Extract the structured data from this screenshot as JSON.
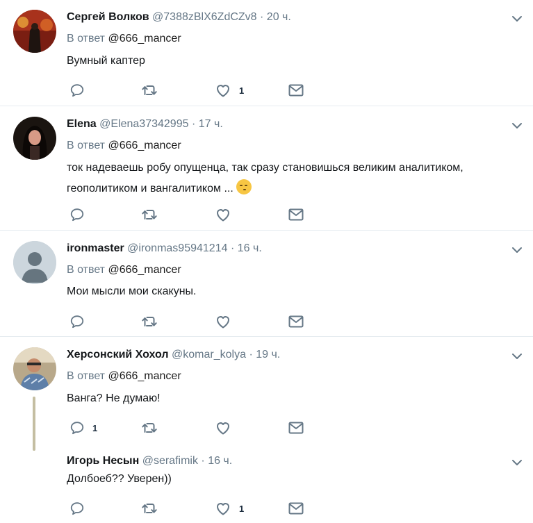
{
  "tweets": [
    {
      "name": "Сергей Волков",
      "handle": "@7388zBlX6ZdCZv8",
      "time": "20 ч.",
      "reply_prefix": "В ответ",
      "reply_to": "@666_mancer",
      "text": "Вумный каптер",
      "reply_count": "",
      "like_count": "1"
    },
    {
      "name": "Elena",
      "handle": "@Elena37342995",
      "time": "17 ч.",
      "reply_prefix": "В ответ",
      "reply_to": "@666_mancer",
      "text_line1": "ток надеваешь робу опущенца, так сразу становишься великим аналитиком,",
      "text_line2": "геополитиком и вангалитиком ...",
      "reply_count": "",
      "like_count": ""
    },
    {
      "name": "ironmaster",
      "handle": "@ironmas95941214",
      "time": "16 ч.",
      "reply_prefix": "В ответ",
      "reply_to": "@666_mancer",
      "text": "Мои мысли мои скакуны.",
      "reply_count": "",
      "like_count": ""
    },
    {
      "name": "Херсонский Хохол",
      "handle": "@komar_kolya",
      "time": "19 ч.",
      "reply_prefix": "В ответ",
      "reply_to": "@666_mancer",
      "text": "Ванга? Не думаю!",
      "reply_count": "1",
      "like_count": ""
    },
    {
      "name": "Игорь Несын",
      "handle": "@serafimik",
      "time": "16 ч.",
      "text": "Долбоеб?? Уверен))",
      "reply_count": "",
      "like_count": "1"
    }
  ],
  "separator": "·",
  "icons": {
    "reply": "reply-icon",
    "retweet": "retweet-icon",
    "like": "like-icon",
    "dm": "direct-message-icon",
    "menu": "chevron-down-icon"
  },
  "colors": {
    "icon": "#657786",
    "divider": "#e6ecf0",
    "thread_line": "#c4bea2"
  }
}
